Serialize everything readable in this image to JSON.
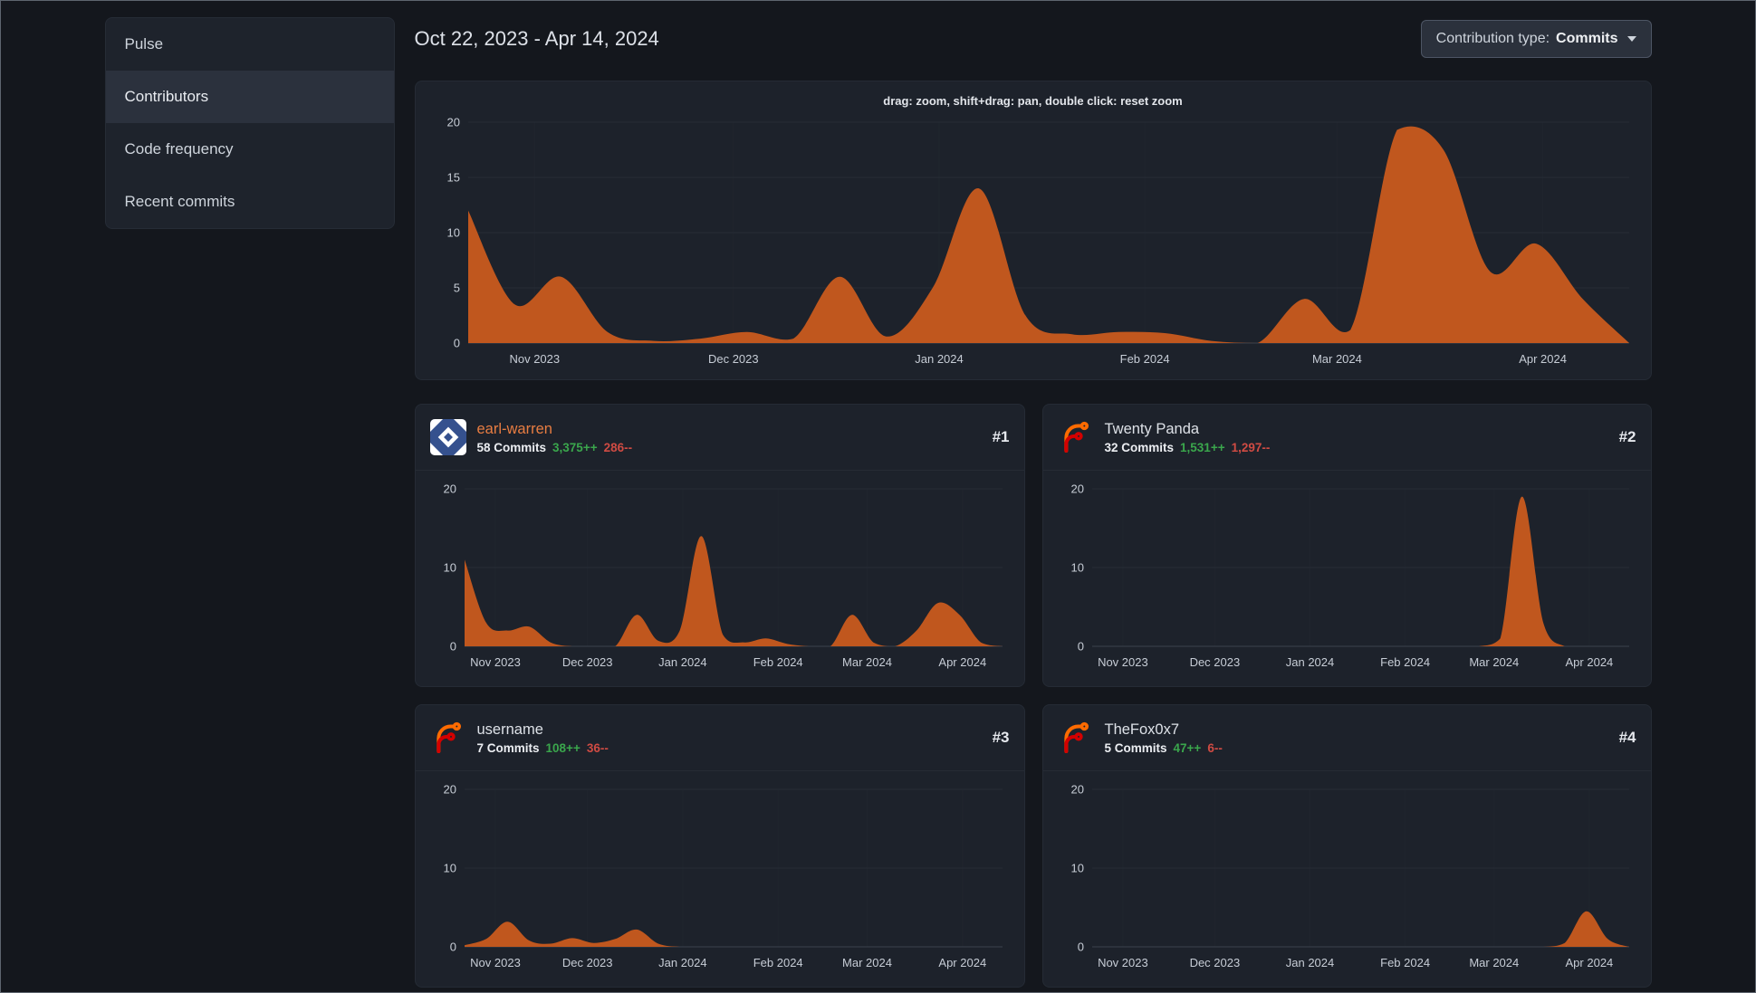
{
  "colors": {
    "area_fill": "#c0571e",
    "link_orange": "#e87d42",
    "additions_green": "#3aa64c",
    "deletions_red": "#cf4b43",
    "forgejo_orange": "#ff6b00",
    "forgejo_red": "#d40000",
    "identicon_bg": "#35518e"
  },
  "sidebar": {
    "items": [
      {
        "label": "Pulse",
        "active": false
      },
      {
        "label": "Contributors",
        "active": true
      },
      {
        "label": "Code frequency",
        "active": false
      },
      {
        "label": "Recent commits",
        "active": false
      }
    ]
  },
  "header": {
    "date_range": "Oct 22, 2023 - Apr 14, 2024",
    "contribution_type_label": "Contribution type:",
    "contribution_type_value": "Commits"
  },
  "main_chart": {
    "hint": "drag: zoom, shift+drag: pan, double click: reset zoom"
  },
  "contributors": [
    {
      "name": "earl-warren",
      "rank": "#1",
      "commits": "58 Commits",
      "additions": "3,375++",
      "deletions": "286--",
      "avatar": "identicon",
      "link": true
    },
    {
      "name": "Twenty Panda",
      "rank": "#2",
      "commits": "32 Commits",
      "additions": "1,531++",
      "deletions": "1,297--",
      "avatar": "forgejo",
      "link": false
    },
    {
      "name": "username",
      "rank": "#3",
      "commits": "7 Commits",
      "additions": "108++",
      "deletions": "36--",
      "avatar": "forgejo",
      "link": false
    },
    {
      "name": "TheFox0x7",
      "rank": "#4",
      "commits": "5 Commits",
      "additions": "47++",
      "deletions": "6--",
      "avatar": "forgejo",
      "link": false
    }
  ],
  "chart_data": [
    {
      "name": "overall-commits-per-week",
      "type": "area",
      "color": "#c0571e",
      "x_start": "2023-10-22",
      "x_end": "2024-04-14",
      "x_unit": "week",
      "ylim": [
        0,
        20
      ],
      "y_ticks": [
        0,
        5,
        10,
        15,
        20
      ],
      "x_tick_labels": [
        "Nov 2023",
        "Dec 2023",
        "Jan 2024",
        "Feb 2024",
        "Mar 2024",
        "Apr 2024"
      ],
      "x_tick_positions": [
        1.43,
        5.71,
        10.14,
        14.57,
        18.71,
        23.14
      ],
      "values": [
        12,
        3.5,
        6,
        1,
        0.2,
        0.4,
        1,
        0.4,
        6,
        0.6,
        5,
        14,
        2.5,
        0.8,
        1,
        0.9,
        0.2,
        0,
        4,
        1.2,
        19.3,
        17.5,
        6.5,
        9,
        4,
        0
      ]
    },
    {
      "name": "earl-warren-commits-per-week",
      "type": "area",
      "color": "#c0571e",
      "x_start": "2023-10-22",
      "x_end": "2024-04-14",
      "x_unit": "week",
      "ylim": [
        0,
        20
      ],
      "y_ticks": [
        0,
        10,
        20
      ],
      "x_tick_labels": [
        "Nov 2023",
        "Dec 2023",
        "Jan 2024",
        "Feb 2024",
        "Mar 2024",
        "Apr 2024"
      ],
      "x_tick_positions": [
        1.43,
        5.71,
        10.14,
        14.57,
        18.71,
        23.14
      ],
      "values": [
        11,
        3,
        2,
        2.5,
        0.5,
        0,
        0,
        0,
        4,
        0.7,
        2,
        14,
        1.5,
        0.5,
        1,
        0.3,
        0,
        0,
        4,
        0.5,
        0,
        2,
        5.5,
        4,
        0.5,
        0
      ]
    },
    {
      "name": "twenty-panda-commits-per-week",
      "type": "area",
      "color": "#c0571e",
      "x_start": "2023-10-22",
      "x_end": "2024-04-14",
      "x_unit": "week",
      "ylim": [
        0,
        20
      ],
      "y_ticks": [
        0,
        10,
        20
      ],
      "x_tick_labels": [
        "Nov 2023",
        "Dec 2023",
        "Jan 2024",
        "Feb 2024",
        "Mar 2024",
        "Apr 2024"
      ],
      "x_tick_positions": [
        1.43,
        5.71,
        10.14,
        14.57,
        18.71,
        23.14
      ],
      "values": [
        0,
        0,
        0,
        0,
        0,
        0,
        0,
        0,
        0,
        0,
        0,
        0,
        0,
        0,
        0,
        0,
        0,
        0,
        0,
        1,
        19,
        3,
        0,
        0,
        0,
        0
      ]
    },
    {
      "name": "username-commits-per-week",
      "type": "area",
      "color": "#c0571e",
      "x_start": "2023-10-22",
      "x_end": "2024-04-14",
      "x_unit": "week",
      "ylim": [
        0,
        20
      ],
      "y_ticks": [
        0,
        10,
        20
      ],
      "x_tick_labels": [
        "Nov 2023",
        "Dec 2023",
        "Jan 2024",
        "Feb 2024",
        "Mar 2024",
        "Apr 2024"
      ],
      "x_tick_positions": [
        1.43,
        5.71,
        10.14,
        14.57,
        18.71,
        23.14
      ],
      "values": [
        0.2,
        1,
        3.2,
        0.8,
        0.4,
        1.1,
        0.5,
        1,
        2.2,
        0.4,
        0,
        0,
        0,
        0,
        0,
        0,
        0,
        0,
        0,
        0,
        0,
        0,
        0,
        0,
        0,
        0
      ]
    },
    {
      "name": "thefox0x7-commits-per-week",
      "type": "area",
      "color": "#c0571e",
      "x_start": "2023-10-22",
      "x_end": "2024-04-14",
      "x_unit": "week",
      "ylim": [
        0,
        20
      ],
      "y_ticks": [
        0,
        10,
        20
      ],
      "x_tick_labels": [
        "Nov 2023",
        "Dec 2023",
        "Jan 2024",
        "Feb 2024",
        "Mar 2024",
        "Apr 2024"
      ],
      "x_tick_positions": [
        1.43,
        5.71,
        10.14,
        14.57,
        18.71,
        23.14
      ],
      "values": [
        0,
        0,
        0,
        0,
        0,
        0,
        0,
        0,
        0,
        0,
        0,
        0,
        0,
        0,
        0,
        0,
        0,
        0,
        0,
        0,
        0,
        0,
        0.5,
        4.5,
        1,
        0
      ]
    }
  ]
}
